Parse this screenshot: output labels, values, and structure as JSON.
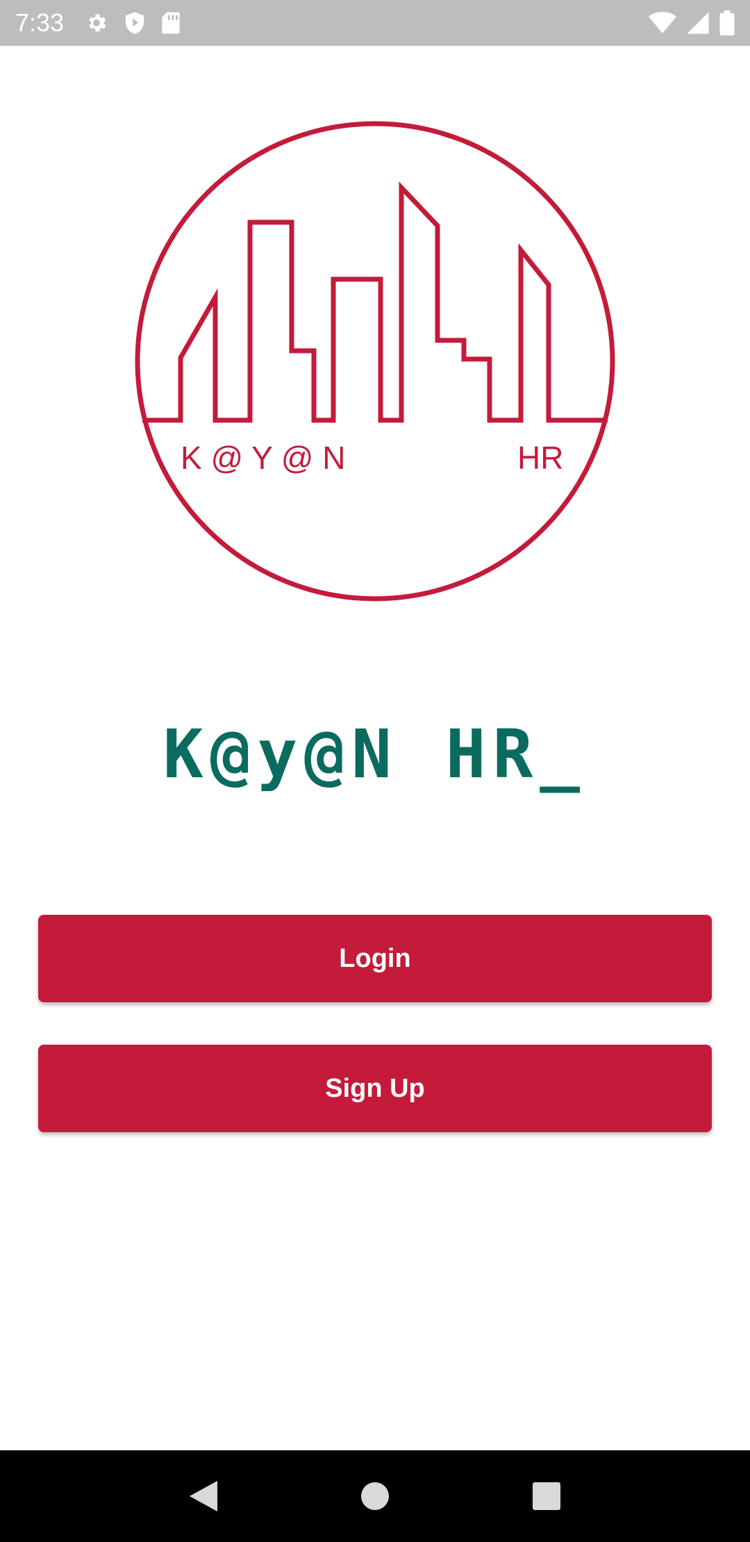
{
  "status_bar": {
    "time": "7:33",
    "left_icons": [
      "gear-icon",
      "shield-icon",
      "sd-card-icon"
    ],
    "right_icons": [
      "wifi-icon",
      "signal-icon",
      "battery-icon"
    ],
    "background": "#bdbdbd"
  },
  "logo": {
    "text_left": "K @ Y @ N",
    "text_right": "HR",
    "color": "#c41b3b"
  },
  "brand": {
    "title": "K@y@N HR_",
    "color": "#0b6b5e"
  },
  "actions": {
    "login_label": "Login",
    "signup_label": "Sign Up",
    "button_color": "#c41b3b"
  },
  "nav_bar": {
    "buttons": [
      "back-icon",
      "home-icon",
      "recents-icon"
    ]
  }
}
